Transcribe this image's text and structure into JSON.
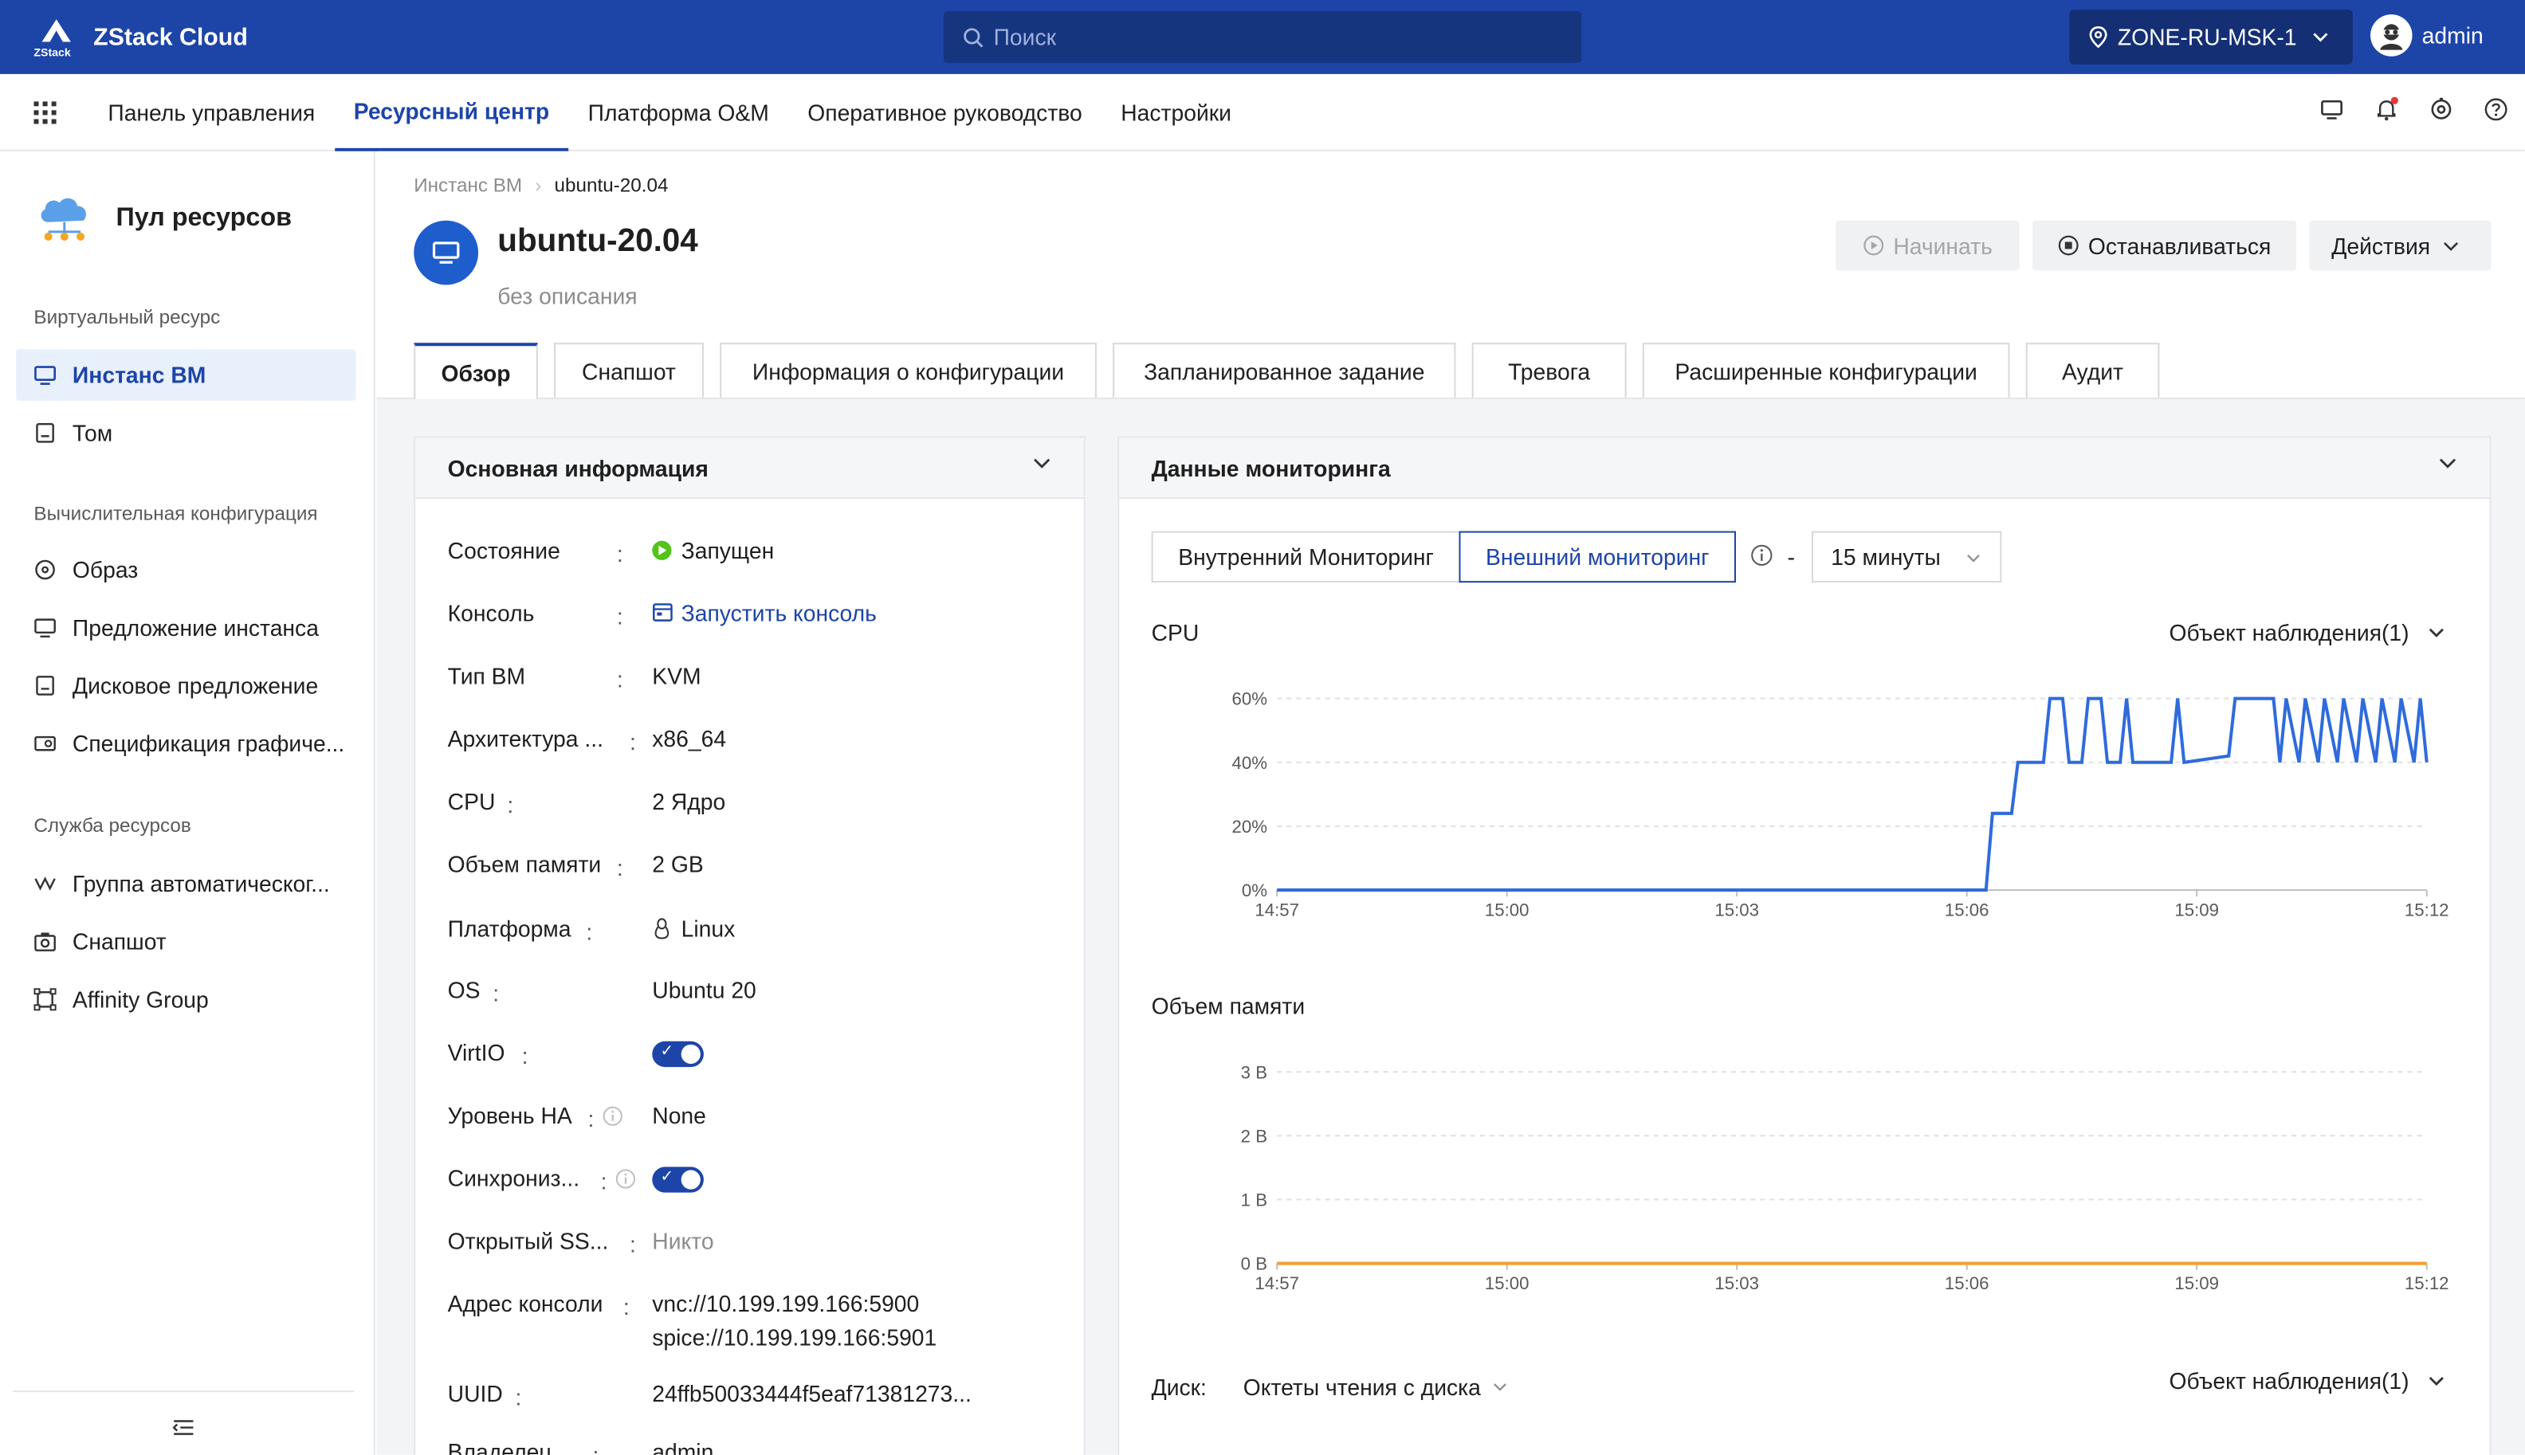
{
  "app": {
    "brand": "ZStack Cloud",
    "logo_text": "ZStack"
  },
  "topbar": {
    "search_placeholder": "Поиск",
    "zone": "ZONE-RU-MSK-1",
    "user": "admin"
  },
  "nav": {
    "items": [
      "Панель управления",
      "Ресурсный центр",
      "Платформа O&M",
      "Оперативное руководство",
      "Настройки"
    ],
    "active": "Ресурсный центр"
  },
  "sidebar": {
    "title": "Пул ресурсов",
    "groups": [
      {
        "title": "Виртуальный ресурс",
        "items": [
          {
            "label": "Инстанс ВМ",
            "icon": "monitor-icon",
            "active": true
          },
          {
            "label": "Том",
            "icon": "disk-icon"
          }
        ]
      },
      {
        "title": "Вычислительная конфигурация",
        "items": [
          {
            "label": "Образ",
            "icon": "disc-icon"
          },
          {
            "label": "Предложение инстанса",
            "icon": "monitor-icon"
          },
          {
            "label": "Дисковое предложение",
            "icon": "disk-icon"
          },
          {
            "label": "Спецификация графиче...",
            "icon": "gpu-icon"
          }
        ]
      },
      {
        "title": "Служба ресурсов",
        "items": [
          {
            "label": "Группа автоматическог...",
            "icon": "scaling-icon"
          },
          {
            "label": "Снапшот",
            "icon": "camera-icon"
          },
          {
            "label": "Affinity Group",
            "icon": "affinity-icon"
          }
        ]
      }
    ]
  },
  "breadcrumb": {
    "parent": "Инстанс ВМ",
    "current": "ubuntu-20.04"
  },
  "vm": {
    "name": "ubuntu-20.04",
    "description": "без описания"
  },
  "actions": {
    "start": "Начинать",
    "stop": "Останавливаться",
    "more": "Действия"
  },
  "tabs": [
    "Обзор",
    "Снапшот",
    "Информация о конфигурации",
    "Запланированное задание",
    "Тревога",
    "Расширенные конфигурации",
    "Аудит"
  ],
  "basic_info": {
    "title": "Основная информация",
    "rows": [
      {
        "key": "Состояние",
        "value": "Запущен",
        "type": "status"
      },
      {
        "key": "Консоль",
        "value": "Запустить консоль",
        "type": "link"
      },
      {
        "key": "Тип ВМ",
        "value": "KVM"
      },
      {
        "key": "Архитектура ...",
        "value": "x86_64"
      },
      {
        "key": "CPU",
        "value": "2 Ядро"
      },
      {
        "key": "Объем памяти",
        "value": "2 GB"
      },
      {
        "key": "Платформа",
        "value": "Linux",
        "type": "platform"
      },
      {
        "key": "OS",
        "value": "Ubuntu 20"
      },
      {
        "key": "VirtIO",
        "value": "",
        "type": "toggle"
      },
      {
        "key": "Уровень HA",
        "value": "None",
        "info": true
      },
      {
        "key": "Синхрониз...",
        "value": "",
        "type": "toggle",
        "info": true
      },
      {
        "key": "Открытый SS...",
        "value": "Никто",
        "type": "muted"
      },
      {
        "key": "Адрес консоли",
        "value": "vnc://10.199.199.166:5900",
        "value2": "spice://10.199.199.166:5901"
      },
      {
        "key": "UUID",
        "value": "24ffb50033444f5eaf71381273..."
      },
      {
        "key": "Владелец",
        "value": "admin"
      }
    ]
  },
  "monitoring": {
    "title": "Данные мониторинга",
    "tabs": [
      "Внутренний Мониторинг",
      "Внешний мониторинг"
    ],
    "active_tab": "Внешний мониторинг",
    "dash": "-",
    "range": "15 минуты",
    "cpu_label": "CPU",
    "object_label": "Объект наблюдения(1)",
    "memory_label": "Объем памяти",
    "disk_label": "Диск:",
    "disk_select": "Октеты чтения с диска"
  },
  "chart_data": [
    {
      "type": "line",
      "title": "CPU",
      "x_ticks": [
        "14:57",
        "15:00",
        "15:03",
        "15:06",
        "15:09",
        "15:12"
      ],
      "y_ticks": [
        "0%",
        "20%",
        "40%",
        "60%"
      ],
      "ylim": [
        0,
        60
      ],
      "series": [
        {
          "color": "#2f6bdb",
          "points": [
            [
              "14:57",
              0
            ],
            [
              "15:06:15",
              0
            ],
            [
              "15:06:20",
              24
            ],
            [
              "15:06:35",
              24
            ],
            [
              "15:06:40",
              40
            ],
            [
              "15:07:00",
              40
            ],
            [
              "15:07:05",
              60
            ],
            [
              "15:07:15",
              60
            ],
            [
              "15:07:20",
              40
            ],
            [
              "15:07:30",
              40
            ],
            [
              "15:07:35",
              60
            ],
            [
              "15:07:45",
              60
            ],
            [
              "15:07:50",
              40
            ],
            [
              "15:08:00",
              40
            ],
            [
              "15:08:05",
              60
            ],
            [
              "15:08:10",
              40
            ],
            [
              "15:08:40",
              40
            ],
            [
              "15:08:45",
              60
            ],
            [
              "15:08:50",
              40
            ],
            [
              "15:09:25",
              42
            ],
            [
              "15:09:30",
              60
            ],
            [
              "15:10:00",
              60
            ],
            [
              "15:10:05",
              40
            ],
            [
              "15:10:10",
              60
            ],
            [
              "15:10:20",
              40
            ],
            [
              "15:10:25",
              60
            ],
            [
              "15:10:35",
              40
            ],
            [
              "15:10:40",
              60
            ],
            [
              "15:10:50",
              40
            ],
            [
              "15:10:55",
              60
            ],
            [
              "15:11:05",
              40
            ],
            [
              "15:11:10",
              60
            ],
            [
              "15:11:20",
              40
            ],
            [
              "15:11:25",
              60
            ],
            [
              "15:11:35",
              40
            ],
            [
              "15:11:40",
              60
            ],
            [
              "15:11:50",
              40
            ],
            [
              "15:11:55",
              60
            ],
            [
              "15:12",
              40
            ]
          ]
        }
      ]
    },
    {
      "type": "line",
      "title": "Объем памяти",
      "x_ticks": [
        "14:57",
        "15:00",
        "15:03",
        "15:06",
        "15:09",
        "15:12"
      ],
      "y_ticks": [
        "0 B",
        "1 B",
        "2 B",
        "3 B"
      ],
      "ylim": [
        0,
        3
      ],
      "series": [
        {
          "color": "#f0a030",
          "points": [
            [
              "14:57",
              0
            ],
            [
              "15:12",
              0
            ]
          ]
        }
      ]
    }
  ]
}
